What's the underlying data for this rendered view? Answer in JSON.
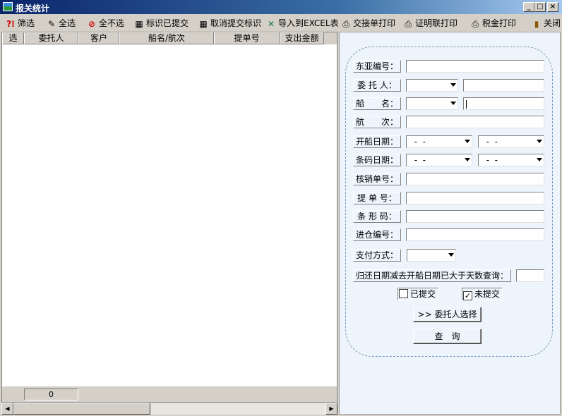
{
  "window": {
    "title": "报关统计",
    "controls": {
      "minimize": "_",
      "maximize": "□",
      "close": "×"
    }
  },
  "toolbar": {
    "filter": "筛选",
    "select_all": "全选",
    "select_none": "全不选",
    "mark_submitted": "标识已提交",
    "cancel_submitted": "取消提交标识",
    "export_excel": "导入到EXCEL表",
    "print_handover": "交接单打印",
    "print_certificate": "证明联打印",
    "print_tax": "税金打印",
    "close": "关闭"
  },
  "grid": {
    "columns": [
      "选",
      "委托人",
      "客户",
      "船名/航次",
      "提单号",
      "支出金额"
    ],
    "rows": [],
    "record_count": "0"
  },
  "form": {
    "dongya_no": {
      "label": "东亚编号：",
      "value": ""
    },
    "consignor": {
      "label": "委 托 人：",
      "select": "",
      "value": ""
    },
    "vessel": {
      "label": "船　　名：",
      "select": "",
      "value": ""
    },
    "voyage": {
      "label": "航　　次：",
      "value": ""
    },
    "sail_date": {
      "label": "开船日期：",
      "from": "  -  -",
      "to": "  -  -"
    },
    "barcode_date": {
      "label": "条码日期：",
      "from": "  -  -",
      "to": "  -  -"
    },
    "verification_no": {
      "label": "核销单号：",
      "value": ""
    },
    "bill_no": {
      "label": "提 单 号：",
      "value": ""
    },
    "barcode": {
      "label": "条 形 码：",
      "value": ""
    },
    "warehouse_no": {
      "label": "进仓编号：",
      "value": ""
    },
    "payment_method": {
      "label": "支付方式：",
      "select": ""
    },
    "days_query": {
      "label": "归还日期减去开船日期已大于天数查询：",
      "value": ""
    },
    "submitted": {
      "label": "已提交",
      "checked": false
    },
    "not_submitted": {
      "label": "未提交",
      "checked": true
    },
    "consignor_select_button": ">> 委托人选择",
    "query_button": "查　询"
  }
}
